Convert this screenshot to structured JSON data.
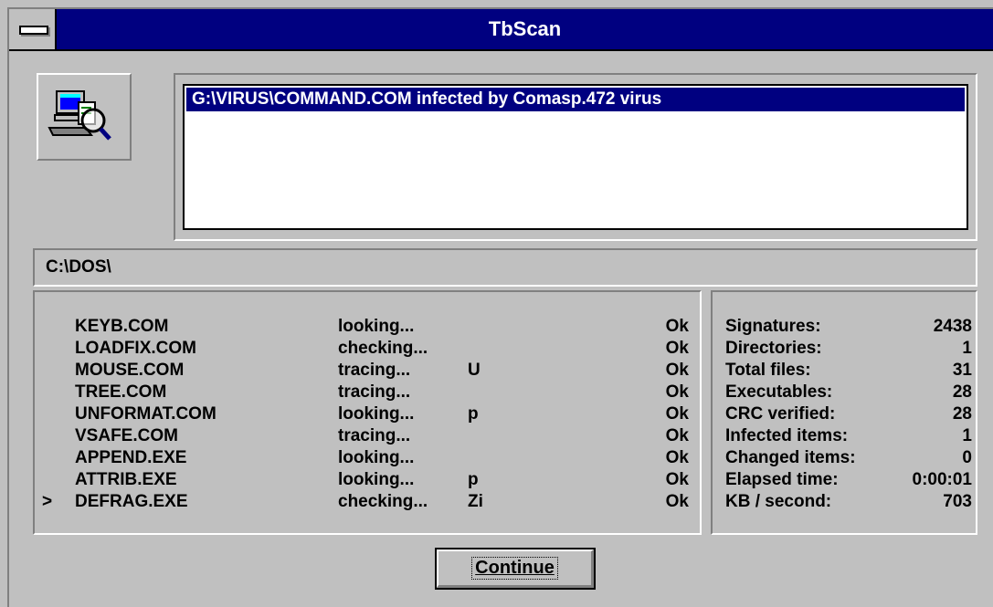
{
  "window": {
    "title": "TbScan"
  },
  "results": {
    "items": [
      "G:\\VIRUS\\COMMAND.COM infected by Comasp.472 virus"
    ]
  },
  "current_path": "C:\\DOS\\",
  "files": [
    {
      "marker": "",
      "name": "KEYB.COM",
      "status": "looking...",
      "flag": "",
      "result": "Ok"
    },
    {
      "marker": "",
      "name": "LOADFIX.COM",
      "status": "checking...",
      "flag": "",
      "result": "Ok"
    },
    {
      "marker": "",
      "name": "MOUSE.COM",
      "status": "tracing...",
      "flag": "U",
      "result": "Ok"
    },
    {
      "marker": "",
      "name": "TREE.COM",
      "status": "tracing...",
      "flag": "",
      "result": "Ok"
    },
    {
      "marker": "",
      "name": "UNFORMAT.COM",
      "status": "looking...",
      "flag": "p",
      "result": "Ok"
    },
    {
      "marker": "",
      "name": "VSAFE.COM",
      "status": "tracing...",
      "flag": "",
      "result": "Ok"
    },
    {
      "marker": "",
      "name": "APPEND.EXE",
      "status": "looking...",
      "flag": "",
      "result": "Ok"
    },
    {
      "marker": "",
      "name": "ATTRIB.EXE",
      "status": "looking...",
      "flag": "p",
      "result": "Ok"
    },
    {
      "marker": ">",
      "name": "DEFRAG.EXE",
      "status": "checking...",
      "flag": "Zi",
      "result": "Ok"
    }
  ],
  "stats": [
    {
      "label": "Signatures:",
      "value": "2438"
    },
    {
      "label": "Directories:",
      "value": "1"
    },
    {
      "label": "Total files:",
      "value": "31"
    },
    {
      "label": "Executables:",
      "value": "28"
    },
    {
      "label": "CRC verified:",
      "value": "28"
    },
    {
      "label": "Infected items:",
      "value": "1"
    },
    {
      "label": "Changed items:",
      "value": "0"
    },
    {
      "label": "Elapsed time:",
      "value": "0:00:01"
    },
    {
      "label": "KB / second:",
      "value": "703"
    }
  ],
  "buttons": {
    "continue": "Continue"
  },
  "icons": {
    "app": "computer-scan-icon",
    "system_menu": "system-menu-icon"
  },
  "colors": {
    "titlebar": "#000080",
    "face": "#c0c0c0",
    "selection": "#000080"
  }
}
